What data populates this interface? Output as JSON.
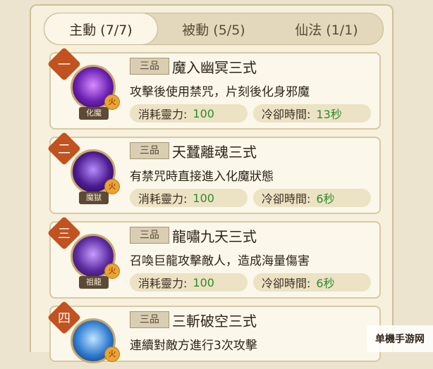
{
  "tabs": [
    {
      "label": "主動 (7/7)"
    },
    {
      "label": "被動 (5/5)"
    },
    {
      "label": "仙法 (1/1)"
    }
  ],
  "skills": [
    {
      "index": "一",
      "portrait_name": "化魔",
      "element": "火",
      "grade": "三品",
      "name": "魔入幽冥三式",
      "description": "攻擊後使用禁咒，片刻後化身邪魔",
      "cost_label": "消耗靈力:",
      "cost": "100",
      "cooldown_label": "冷卻時間:",
      "cooldown": "13秒"
    },
    {
      "index": "二",
      "portrait_name": "魔獄",
      "element": "火",
      "grade": "三品",
      "name": "天蠶離魂三式",
      "description": "有禁咒時直接進入化魔狀態",
      "cost_label": "消耗靈力:",
      "cost": "100",
      "cooldown_label": "冷卻時間:",
      "cooldown": "6秒"
    },
    {
      "index": "三",
      "portrait_name": "祖龍",
      "element": "火",
      "grade": "三品",
      "name": "龍嘯九天三式",
      "description": "召喚巨龍攻擊敵人，造成海量傷害",
      "cost_label": "消耗靈力:",
      "cost": "100",
      "cooldown_label": "冷卻時間:",
      "cooldown": "6秒"
    },
    {
      "index": "四",
      "portrait_name": "",
      "element": "火",
      "grade": "三品",
      "name": "三斬破空三式",
      "description": "連續對敵方進行3次攻擊",
      "cost_label": "",
      "cost": "",
      "cooldown_label": "",
      "cooldown": ""
    }
  ],
  "watermark": "单機手游网",
  "colors": {
    "accent": "#c2521f",
    "value_green": "#2f8a2b"
  }
}
